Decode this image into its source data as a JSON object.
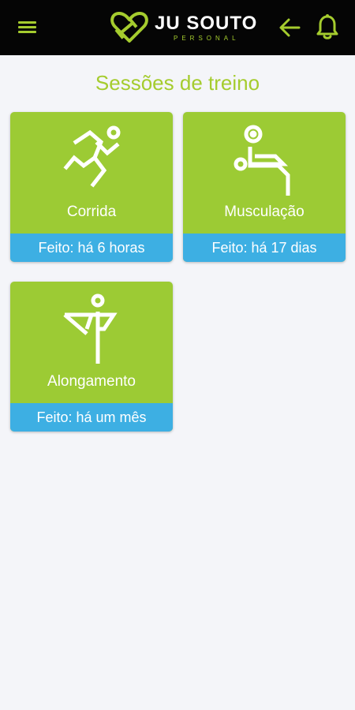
{
  "app": {
    "logo_title": "JU SOUTO",
    "logo_subtitle": "PERSONAL",
    "accent_color": "#a5cc2e",
    "status_color": "#3dafe3"
  },
  "header": {
    "menu_icon": "hamburger-menu-icon",
    "back_icon": "arrow-left-icon",
    "notification_icon": "bell-icon"
  },
  "page": {
    "title": "Sessões de treino"
  },
  "sessions": [
    {
      "label": "Corrida",
      "status": "Feito: há 6 horas",
      "icon": "running-person-icon"
    },
    {
      "label": "Musculação",
      "status": "Feito: há 17 dias",
      "icon": "bench-press-icon"
    },
    {
      "label": "Alongamento",
      "status": "Feito: há um mês",
      "icon": "stretching-person-icon"
    }
  ]
}
